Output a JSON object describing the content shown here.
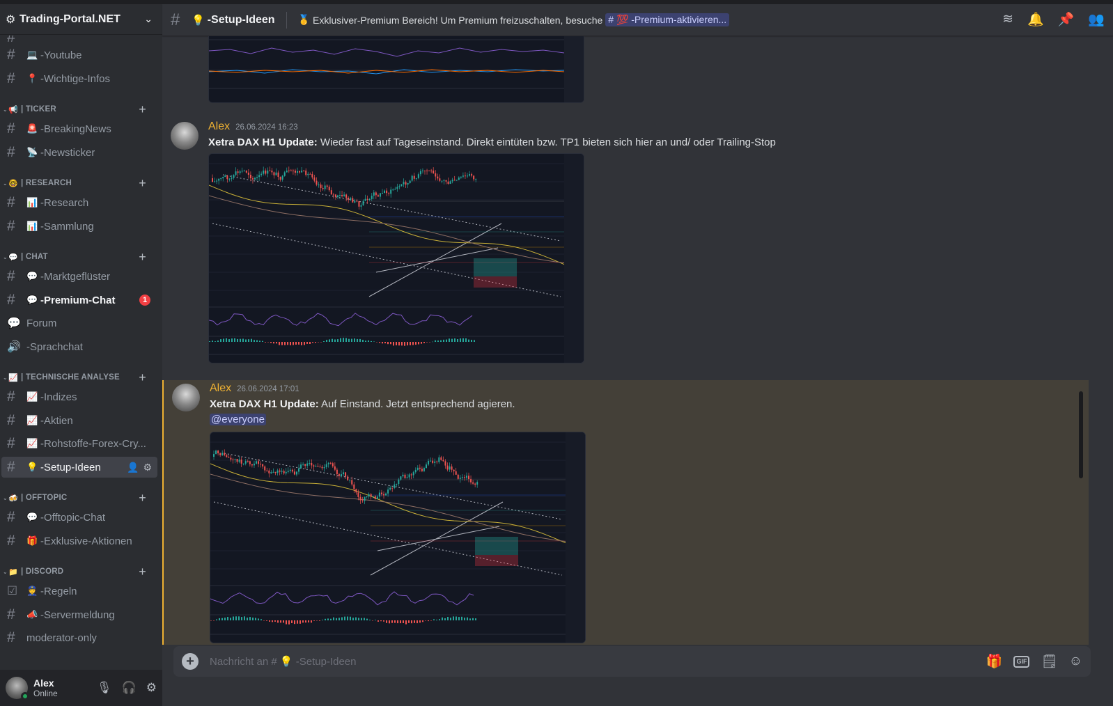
{
  "server": {
    "name": "Trading-Portal.NET",
    "settings_icon": "gear-icon",
    "dropdown_icon": "chevron-down-icon"
  },
  "sidebar": {
    "channels_top": [
      {
        "emoji": "💻",
        "label": "-Youtube"
      },
      {
        "emoji": "📍",
        "label": "-Wichtige-Infos"
      }
    ],
    "categories": [
      {
        "emoji": "📢",
        "label": "| TICKER",
        "channels": [
          {
            "emoji": "🚨",
            "label": "-BreakingNews"
          },
          {
            "emoji": "📡",
            "label": "-Newsticker"
          }
        ]
      },
      {
        "emoji": "🤓",
        "label": "| RESEARCH",
        "channels": [
          {
            "emoji": "📊",
            "label": "-Research"
          },
          {
            "emoji": "📊",
            "label": "-Sammlung"
          }
        ]
      },
      {
        "emoji": "💬",
        "label": "| CHAT",
        "channels": [
          {
            "emoji": "💬",
            "label": "-Marktgeflüster"
          },
          {
            "emoji": "💬",
            "label": "-Premium-Chat",
            "badge": "1"
          },
          {
            "emoji": "",
            "label": "Forum"
          },
          {
            "emoji": "",
            "label": "-Sprachchat"
          }
        ]
      },
      {
        "emoji": "📈",
        "label": "| TECHNISCHE ANALYSE",
        "channels": [
          {
            "emoji": "📈",
            "label": "-Indizes"
          },
          {
            "emoji": "📈",
            "label": "-Aktien"
          },
          {
            "emoji": "📈",
            "label": "-Rohstoffe-Forex-Cry..."
          },
          {
            "emoji": "💡",
            "label": "-Setup-Ideen"
          }
        ]
      },
      {
        "emoji": "🍻",
        "label": "| OFFTOPIC",
        "channels": [
          {
            "emoji": "💬",
            "label": "-Offtopic-Chat"
          },
          {
            "emoji": "🎁",
            "label": "-Exklusive-Aktionen"
          }
        ]
      },
      {
        "emoji": "📁",
        "label": "| DISCORD",
        "channels": [
          {
            "emoji": "👮",
            "label": "-Regeln"
          },
          {
            "emoji": "📣",
            "label": "-Servermeldung"
          },
          {
            "emoji": "",
            "label": "moderator-only"
          }
        ]
      }
    ]
  },
  "user": {
    "name": "Alex",
    "status": "Online"
  },
  "header": {
    "channel_emoji": "💡",
    "channel_name": "-Setup-Ideen",
    "topic_emoji": "🥇",
    "topic_text": "Exklusiver-Premium Bereich! Um Premium freizuschalten, besuche",
    "topic_link": "# 💯 -Premium-aktivieren..."
  },
  "messages": [
    {
      "author": "Alex",
      "timestamp": "26.06.2024 16:23",
      "bold": "Xetra DAX H1 Update:",
      "text": " Wieder fast auf Tageseinstand. Direkt eintüten bzw. TP1 bieten sich hier an und/ oder Trailing-Stop"
    },
    {
      "author": "Alex",
      "timestamp": "26.06.2024 17:01",
      "bold": "Xetra DAX H1 Update:",
      "text": " Auf Einstand. Jetzt entsprechend agieren.",
      "mention": "@everyone"
    }
  ],
  "composer": {
    "placeholder_prefix": "Nachricht an #",
    "placeholder_emoji": "💡",
    "placeholder_channel": "-Setup-Ideen"
  },
  "colors": {
    "accent_author": "#f0b232",
    "mention_bg": "#3c4270",
    "highlight_bg": "#444038",
    "badge": "#f23f43",
    "online": "#23a55a"
  }
}
